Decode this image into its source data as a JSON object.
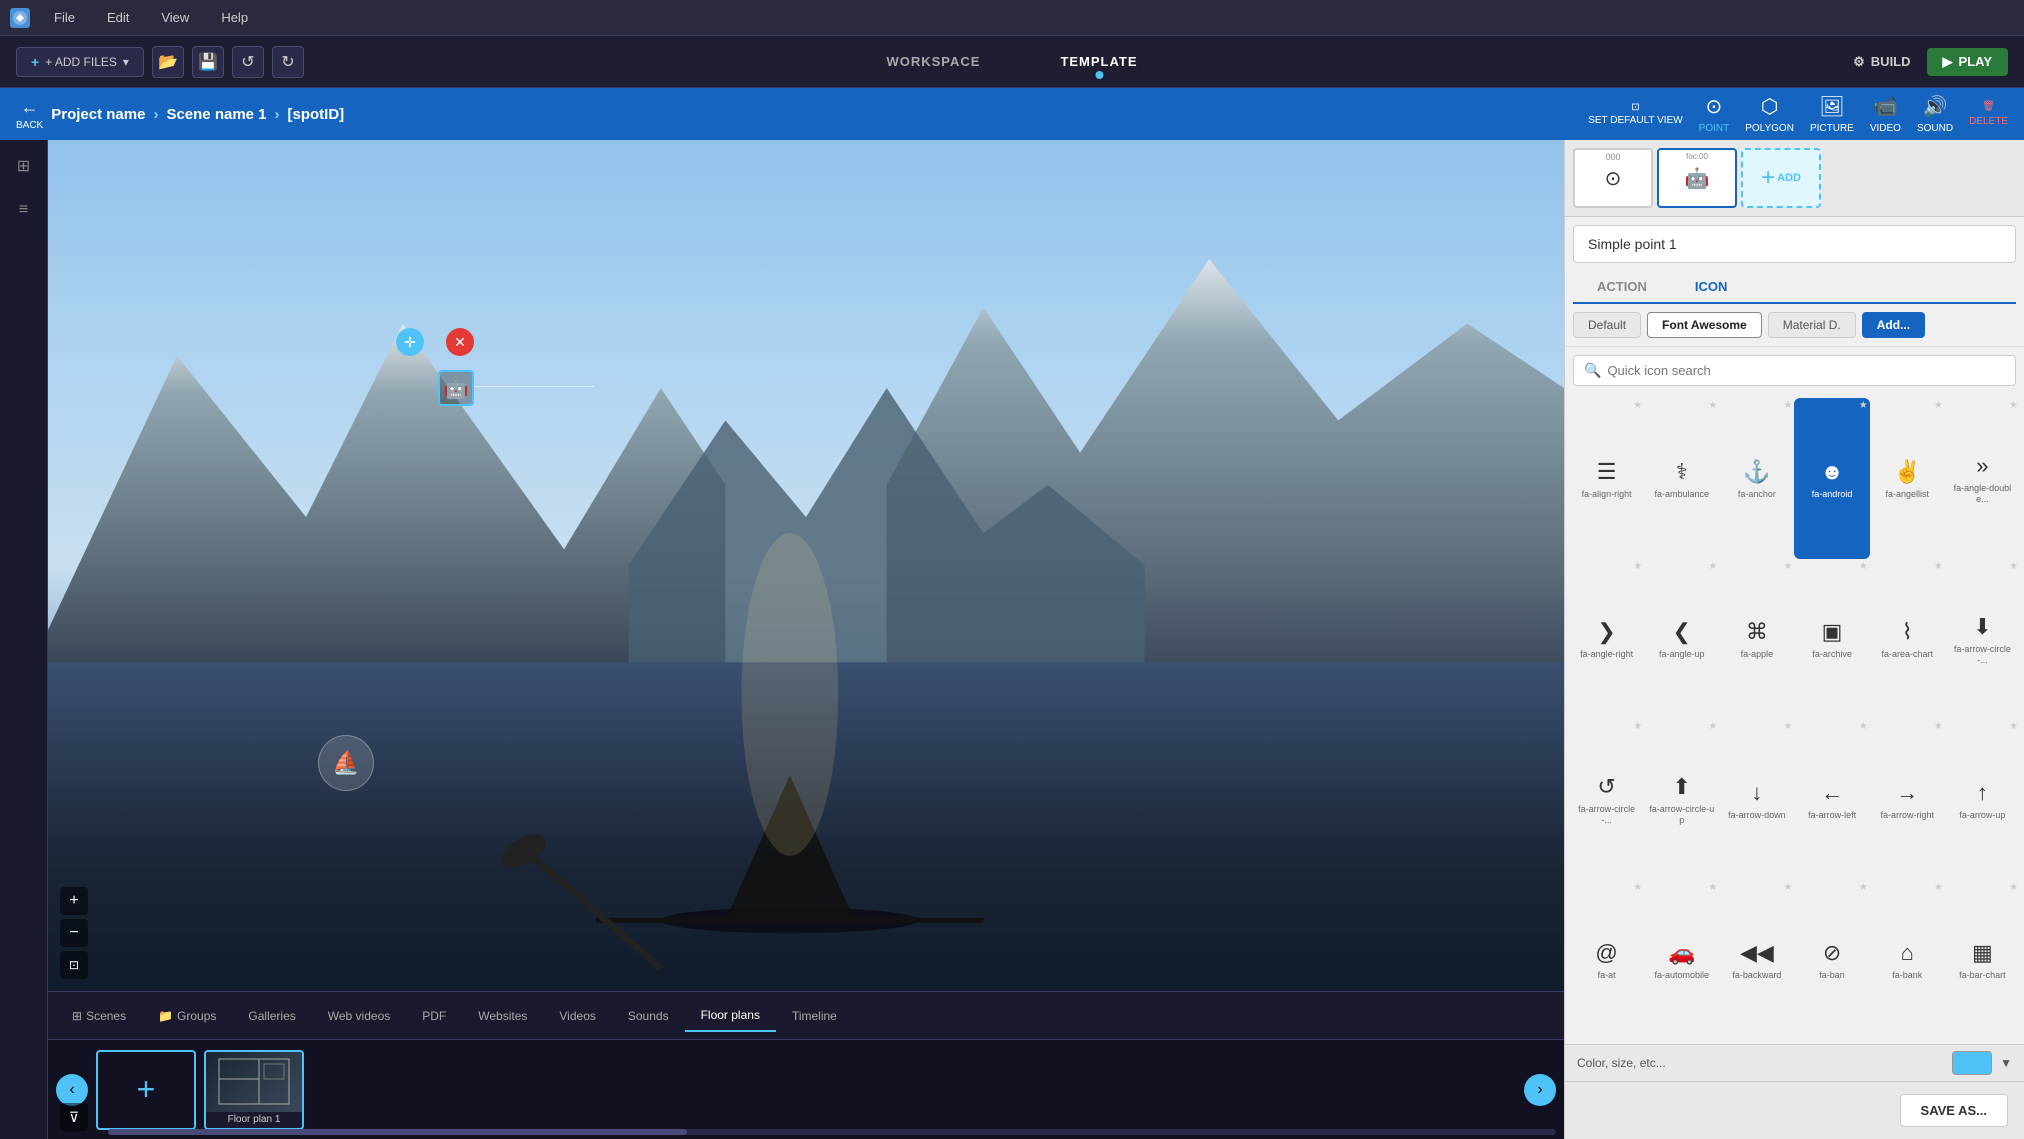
{
  "app": {
    "logo": "V",
    "menu_items": [
      "File",
      "Edit",
      "View",
      "Help"
    ]
  },
  "toolbar": {
    "add_files_label": "+ ADD FILES",
    "workspace_tab": "WORKSPACE",
    "template_tab": "TEMPLATE",
    "build_label": "BUILD",
    "play_label": "PLAY"
  },
  "scene_header": {
    "back_label": "BACK",
    "project_name": "Project name",
    "scene_name": "Scene name 1",
    "spot_id": "[spotID]",
    "set_default_label": "SET DEFAULT VIEW",
    "tools": [
      {
        "id": "point",
        "label": "POINT",
        "icon": "⊙"
      },
      {
        "id": "polygon",
        "label": "POLYGON",
        "icon": "⬡"
      },
      {
        "id": "picture",
        "label": "PICTURE",
        "icon": "🖼"
      },
      {
        "id": "video",
        "label": "VIDEO",
        "icon": "📹"
      },
      {
        "id": "sound",
        "label": "SOUND",
        "icon": "🔊"
      }
    ],
    "delete_label": "DELETE"
  },
  "icon_thumbs": [
    {
      "id": "default",
      "icon": "⊙",
      "label": ""
    },
    {
      "id": "android",
      "icon": "🤖",
      "label": "foc:00"
    }
  ],
  "point_name": "Simple point 1",
  "panel_tabs": [
    "ACTION",
    "ICON"
  ],
  "active_panel_tab": "ICON",
  "icon_sources": [
    "Default",
    "Font Awesome",
    "Material D.",
    "Add..."
  ],
  "active_icon_source": "Font Awesome",
  "search_placeholder": "Quick icon search",
  "icon_grid": [
    {
      "id": "fa-align-right",
      "label": "fa-align-right",
      "sym": "≡",
      "starred": false,
      "selected": false
    },
    {
      "id": "fa-ambulance",
      "label": "fa-ambulance",
      "sym": "🚑",
      "starred": false,
      "selected": false
    },
    {
      "id": "fa-anchor",
      "label": "fa-anchor",
      "sym": "⚓",
      "starred": false,
      "selected": false
    },
    {
      "id": "fa-android",
      "label": "fa-android",
      "sym": "🤖",
      "starred": false,
      "selected": true
    },
    {
      "id": "fa-angellist",
      "label": "fa-angellist",
      "sym": "✌",
      "starred": false,
      "selected": false
    },
    {
      "id": "fa-angle-double",
      "label": "fa-angle-double...",
      "sym": "»",
      "starred": false,
      "selected": false
    },
    {
      "id": "fa-angle-right",
      "label": "fa-angle-right",
      "sym": "›",
      "starred": false,
      "selected": false
    },
    {
      "id": "fa-angle-up",
      "label": "fa-angle-up",
      "sym": "^",
      "starred": false,
      "selected": false
    },
    {
      "id": "fa-apple",
      "label": "fa-apple",
      "sym": "🍎",
      "starred": false,
      "selected": false
    },
    {
      "id": "fa-archive",
      "label": "fa-archive",
      "sym": "📦",
      "starred": false,
      "selected": false
    },
    {
      "id": "fa-area-chart",
      "label": "fa-area-chart",
      "sym": "📈",
      "starred": false,
      "selected": false
    },
    {
      "id": "fa-arrow-circle",
      "label": "fa-arrow-circle-...",
      "sym": "⬇",
      "starred": false,
      "selected": false
    },
    {
      "id": "fa-arrow-circle-l",
      "label": "fa-arrow-circle-...",
      "sym": "↻",
      "starred": false,
      "selected": false
    },
    {
      "id": "fa-arrow-circle-up",
      "label": "fa-arrow-circle-up",
      "sym": "⬆",
      "starred": false,
      "selected": false
    },
    {
      "id": "fa-arrow-down",
      "label": "fa-arrow-down",
      "sym": "↓",
      "starred": false,
      "selected": false
    },
    {
      "id": "fa-arrow-left",
      "label": "fa-arrow-left",
      "sym": "←",
      "starred": false,
      "selected": false
    },
    {
      "id": "fa-arrow-right",
      "label": "fa-arrow-right",
      "sym": "→",
      "starred": false,
      "selected": false
    },
    {
      "id": "fa-arrow-up",
      "label": "fa-arrow-up",
      "sym": "↑",
      "starred": false,
      "selected": false
    },
    {
      "id": "fa-at",
      "label": "fa-at",
      "sym": "@",
      "starred": false,
      "selected": false
    },
    {
      "id": "fa-automobile",
      "label": "fa-automobile",
      "sym": "🚗",
      "starred": false,
      "selected": false
    },
    {
      "id": "fa-backward",
      "label": "fa-backward",
      "sym": "⏮",
      "starred": false,
      "selected": false
    },
    {
      "id": "fa-ban",
      "label": "fa-ban",
      "sym": "🚫",
      "starred": false,
      "selected": false
    },
    {
      "id": "fa-bank",
      "label": "fa-bank",
      "sym": "🏛",
      "starred": false,
      "selected": false
    },
    {
      "id": "fa-bar-chart",
      "label": "fa-bar-chart",
      "sym": "📊",
      "starred": false,
      "selected": false
    }
  ],
  "color_label": "Color, size, etc...",
  "color_value": "#4fc3f7",
  "save_as_label": "SAVE AS...",
  "bottom_tabs": [
    "Scenes",
    "Groups",
    "Galleries",
    "Web videos",
    "PDF",
    "Websites",
    "Videos",
    "Sounds",
    "Floor plans",
    "Timeline"
  ],
  "active_bottom_tab": "Floor plans",
  "floor_plan_thumb_label": "Floor plan 1",
  "canvas": {
    "compass_icon": "⛵"
  }
}
